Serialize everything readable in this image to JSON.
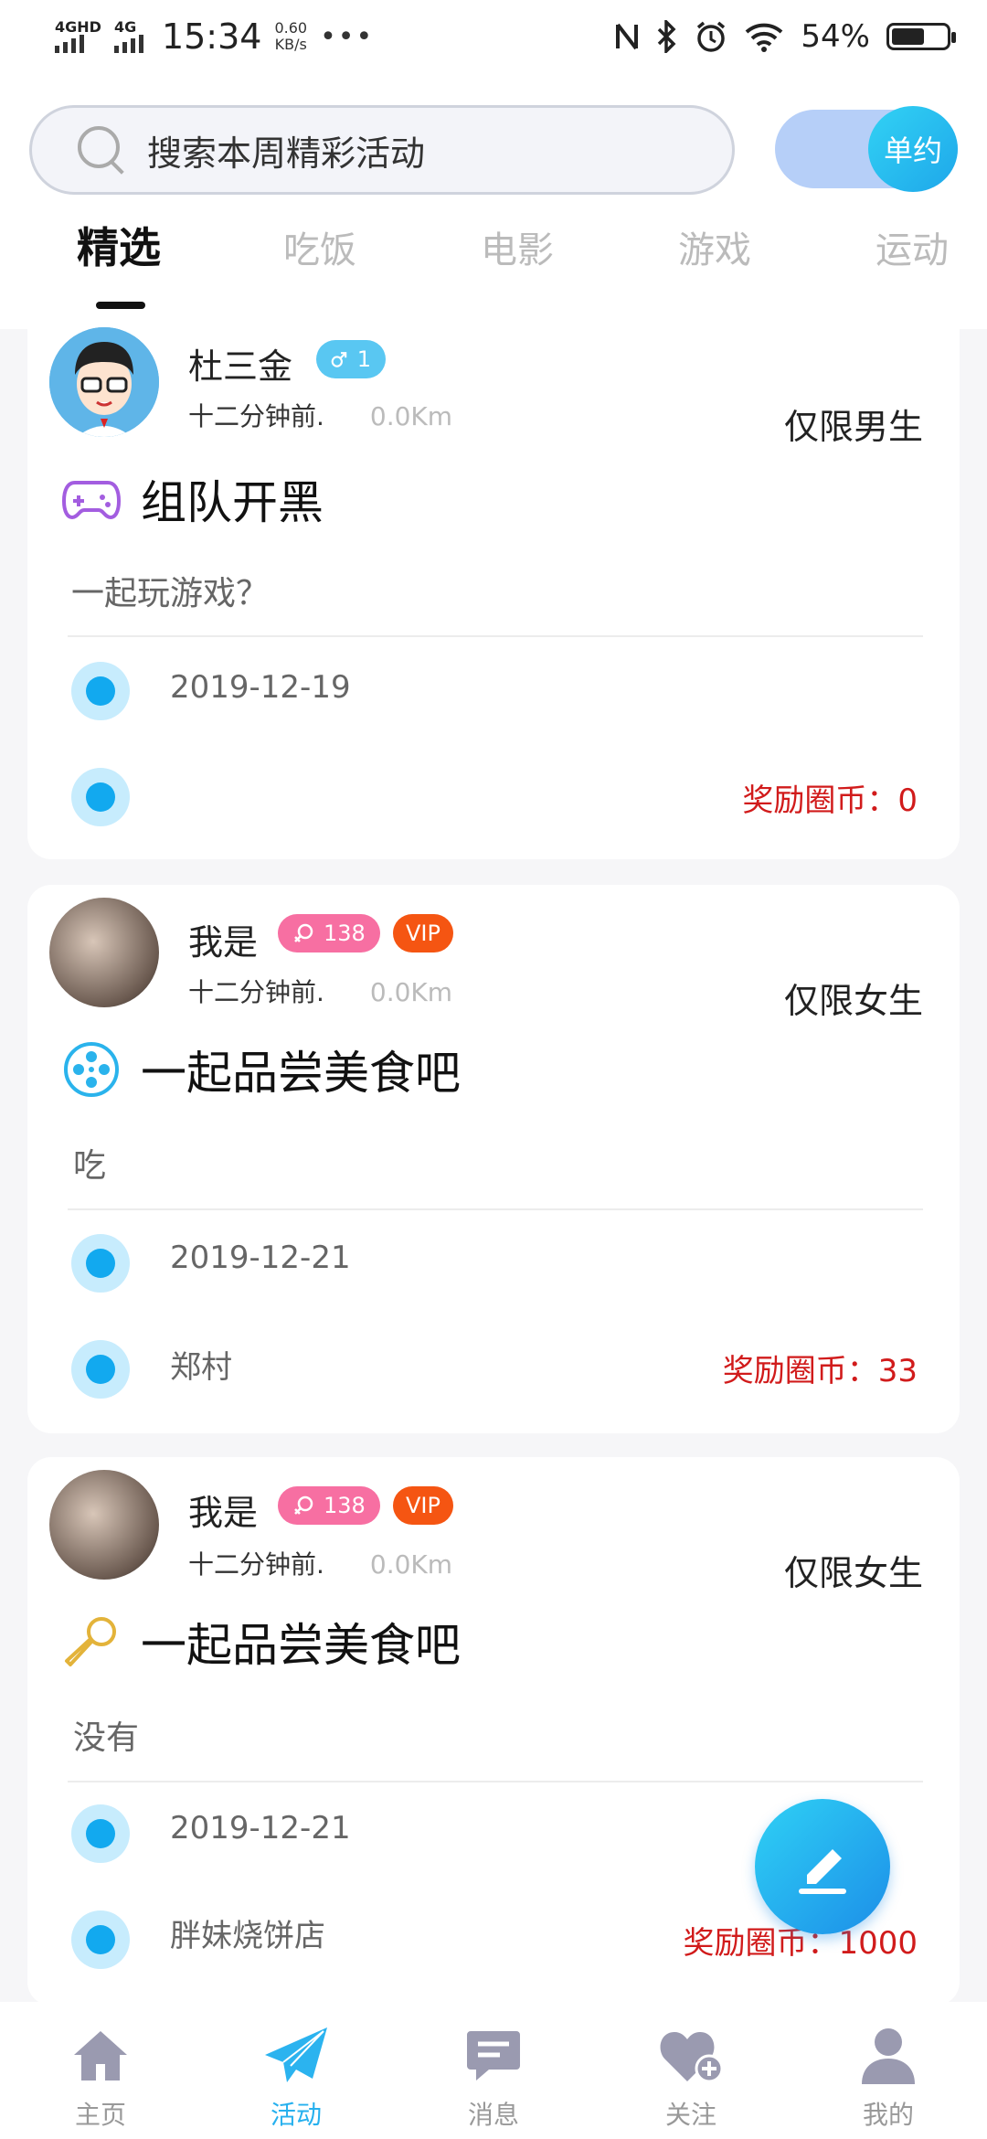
{
  "status_bar": {
    "net1": "4GHD",
    "net2": "4G",
    "time": "15:34",
    "speed_value": "0.60",
    "speed_unit": "KB/s",
    "more": "•••",
    "battery": "54%"
  },
  "header": {
    "search_placeholder": "搜索本周精彩活动",
    "toggle_label": "单约",
    "tabs": [
      "精选",
      "吃饭",
      "电影",
      "游戏",
      "运动"
    ],
    "active_tab": "精选"
  },
  "cards": [
    {
      "name": "杜三金",
      "gender": "male",
      "gender_badge": "1",
      "vip": "",
      "time_ago": "十二分钟前.",
      "distance": "0.0Km",
      "limit": "仅限男生",
      "title_icon": "gamepad-icon",
      "title": "组队开黑",
      "desc": "一起玩游戏？",
      "date": "2019-12-19",
      "location": "",
      "reward": "奖励圈币：0"
    },
    {
      "name": "我是",
      "gender": "female",
      "gender_badge": "138",
      "vip": "VIP",
      "time_ago": "十二分钟前.",
      "distance": "0.0Km",
      "limit": "仅限女生",
      "title_icon": "film-reel-icon",
      "title": "一起品尝美食吧",
      "desc": "吃",
      "date": "2019-12-21",
      "location": "郑村",
      "reward": "奖励圈币：33"
    },
    {
      "name": "我是",
      "gender": "female",
      "gender_badge": "138",
      "vip": "VIP",
      "time_ago": "十二分钟前.",
      "distance": "0.0Km",
      "limit": "仅限女生",
      "title_icon": "microphone-icon",
      "title": "一起品尝美食吧",
      "desc": "没有",
      "date": "2019-12-21",
      "location": "胖妹烧饼店",
      "reward": "奖励圈币：1000"
    }
  ],
  "bottom_nav": [
    {
      "label": "主页",
      "icon": "home-icon"
    },
    {
      "label": "活动",
      "icon": "paper-plane-icon"
    },
    {
      "label": "消息",
      "icon": "message-icon"
    },
    {
      "label": "关注",
      "icon": "heart-plus-icon"
    },
    {
      "label": "我的",
      "icon": "user-icon"
    }
  ],
  "colors": {
    "accent": "#26b0ee",
    "reward": "#d11b1b",
    "female_badge": "#f76fa2",
    "male_badge": "#59c7f2",
    "vip_badge": "#f55512"
  }
}
